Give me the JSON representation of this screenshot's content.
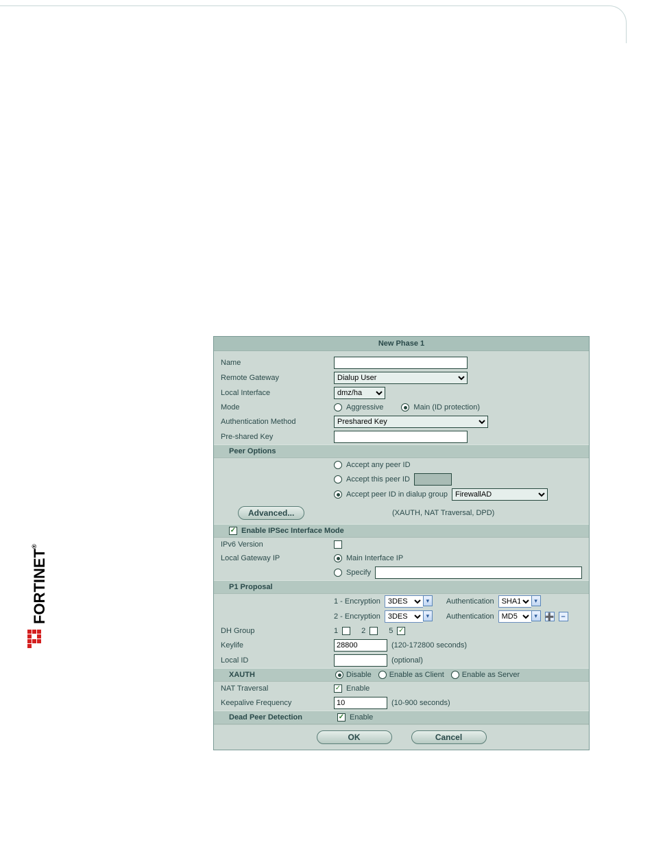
{
  "dialog": {
    "title": "New Phase 1",
    "name_label": "Name",
    "name_value": "",
    "remote_gw_label": "Remote Gateway",
    "remote_gw_value": "Dialup User",
    "local_if_label": "Local Interface",
    "local_if_value": "dmz/ha",
    "mode_label": "Mode",
    "mode_aggressive": "Aggressive",
    "mode_main": "Main (ID protection)",
    "auth_method_label": "Authentication Method",
    "auth_method_value": "Preshared Key",
    "psk_label": "Pre-shared Key",
    "psk_value": "",
    "peer_options_head": "Peer Options",
    "peer_any": "Accept any peer ID",
    "peer_this": "Accept this peer ID",
    "peer_this_value": "",
    "peer_group": "Accept peer ID in dialup group",
    "peer_group_value": "FirewallAD",
    "advanced_btn": "Advanced...",
    "advanced_hint": "(XAUTH, NAT Traversal, DPD)",
    "ipsec_mode_head": "Enable IPSec Interface Mode",
    "ipv6_label": "IPv6 Version",
    "localgw_label": "Local Gateway IP",
    "localgw_main": "Main Interface IP",
    "localgw_specify": "Specify",
    "localgw_specify_value": "",
    "p1_head": "P1 Proposal",
    "enc1_prefix": "1 - Encryption",
    "enc2_prefix": "2 - Encryption",
    "auth_lbl": "Authentication",
    "enc_value": "3DES",
    "auth1_value": "SHA1",
    "auth2_value": "MD5",
    "dh_label": "DH Group",
    "dh1": "1",
    "dh2": "2",
    "dh5": "5",
    "keylife_label": "Keylife",
    "keylife_value": "28800",
    "keylife_hint": "(120-172800 seconds)",
    "localid_label": "Local ID",
    "localid_value": "",
    "localid_hint": "(optional)",
    "xauth_head": "XAUTH",
    "xauth_disable": "Disable",
    "xauth_client": "Enable as Client",
    "xauth_server": "Enable as Server",
    "nat_label": "NAT Traversal",
    "enable_lbl": "Enable",
    "keepalive_label": "Keepalive Frequency",
    "keepalive_value": "10",
    "keepalive_hint": "(10-900 seconds)",
    "dpd_head": "Dead Peer Detection",
    "ok_btn": "OK",
    "cancel_btn": "Cancel"
  },
  "logo": {
    "text": "FORTINET",
    "reg": "®"
  }
}
